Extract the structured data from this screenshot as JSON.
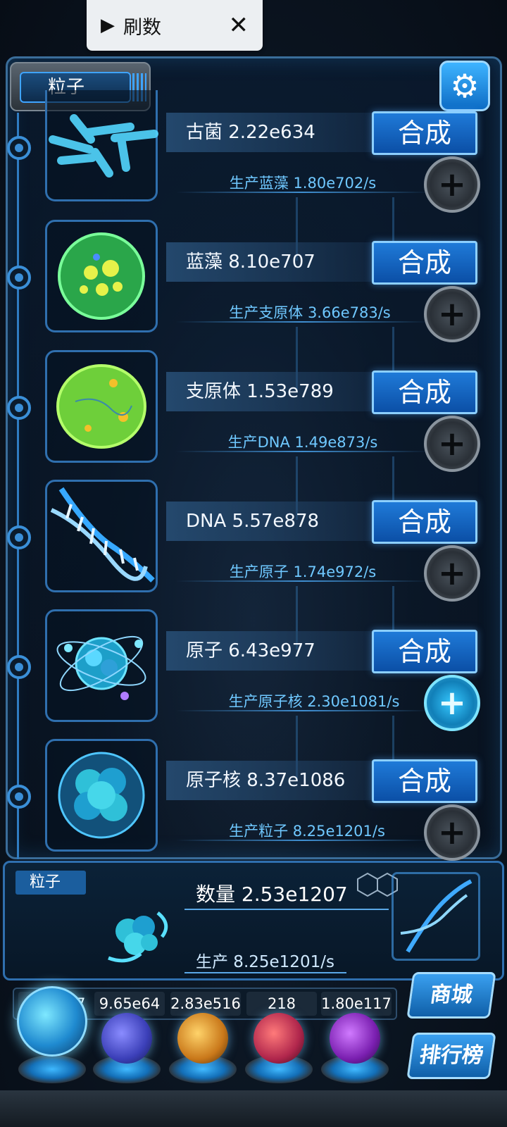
{
  "overlay": {
    "label": "刷数",
    "play_icon": "play-icon",
    "close_icon": "close-icon"
  },
  "header": {
    "title": "粒子",
    "settings_icon": "gear-icon"
  },
  "synth_label": "合成",
  "rows": [
    {
      "name": "古菌 2.22e634",
      "production": "生产蓝藻 1.80e702/s",
      "icon": "archaea-icon",
      "plus_active": false
    },
    {
      "name": "蓝藻 8.10e707",
      "production": "生产支原体 3.66e783/s",
      "icon": "cyanobacteria-icon",
      "plus_active": false
    },
    {
      "name": "支原体 1.53e789",
      "production": "生产DNA 1.49e873/s",
      "icon": "mycoplasma-icon",
      "plus_active": false
    },
    {
      "name": "DNA 5.57e878",
      "production": "生产原子 1.74e972/s",
      "icon": "dna-icon",
      "plus_active": false
    },
    {
      "name": "原子 6.43e977",
      "production": "生产原子核 2.30e1081/s",
      "icon": "atom-icon",
      "plus_active": true
    },
    {
      "name": "原子核 8.37e1086",
      "production": "生产粒子 8.25e1201/s",
      "icon": "nucleus-icon",
      "plus_active": false
    }
  ],
  "particle": {
    "tag": "粒子",
    "quantity": "数量 2.53e1207",
    "production": "生产 8.25e1201/s"
  },
  "currencies": [
    "2",
    "07",
    "9.65e64",
    "2.83e516",
    "218",
    "1.80e117"
  ],
  "side_buttons": {
    "shop": "商城",
    "leaderboard": "排行榜"
  },
  "colors": {
    "accent": "#1f7ad8",
    "frame": "#2f6fae",
    "production_text": "#6fc8ff"
  }
}
